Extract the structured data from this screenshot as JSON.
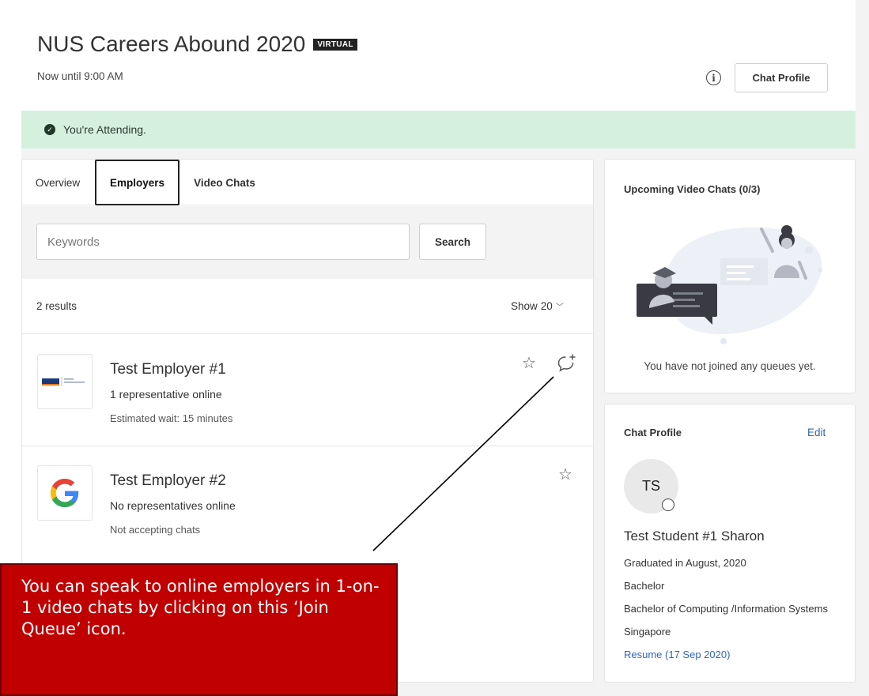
{
  "event": {
    "title": "NUS Careers Abound 2020",
    "badge": "VIRTUAL",
    "time": "Now until 9:00 AM",
    "chat_profile_button": "Chat Profile"
  },
  "banner": {
    "text": "You're Attending."
  },
  "tabs": [
    {
      "label": "Overview",
      "active": false
    },
    {
      "label": "Employers",
      "active": true
    },
    {
      "label": "Video Chats",
      "active": false
    }
  ],
  "search": {
    "placeholder": "Keywords",
    "button": "Search"
  },
  "results": {
    "count_text": "2 results",
    "show_label": "Show",
    "show_value": "20"
  },
  "employers": [
    {
      "name": "Test Employer #1",
      "line1": "1 representative online",
      "line2": "Estimated wait: 15 minutes",
      "logo": "nus-logo",
      "queue_available": true
    },
    {
      "name": "Test Employer #2",
      "line1": "No representatives online",
      "line2": "Not accepting chats",
      "logo": "google-g-logo",
      "queue_available": false
    }
  ],
  "upcoming": {
    "title": "Upcoming Video Chats (0/3)",
    "empty_text": "You have not joined any queues yet."
  },
  "profile": {
    "title": "Chat Profile",
    "edit": "Edit",
    "initials": "TS",
    "name": "Test Student #1 Sharon",
    "graduated": "Graduated in August, 2020",
    "degree": "Bachelor",
    "major": "Bachelor of Computing /Information Systems",
    "country": "Singapore",
    "resume": "Resume (17 Sep 2020)"
  },
  "callout": {
    "text": "You can speak to online employers in 1-on-1 video chats by clicking on this ‘Join Queue’ icon."
  },
  "colors": {
    "banner_bg": "#d5f1de",
    "link": "#2f66c2",
    "callout_bg": "#c00000"
  }
}
